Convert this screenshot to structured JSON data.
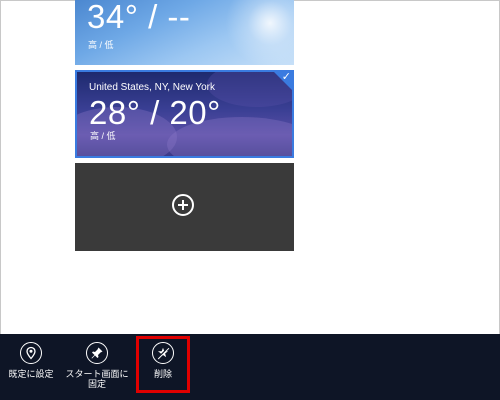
{
  "tiles": [
    {
      "temperature": "34° / --",
      "hilo_label": "高 / 低",
      "selected": false
    },
    {
      "location": "United States, NY, New York",
      "temperature": "28° / 20°",
      "hilo_label": "高 / 低",
      "selected": true
    }
  ],
  "add_tile": {
    "icon": "add-circle-icon"
  },
  "appbar": {
    "commands": [
      {
        "label": "既定に設定",
        "icon": "location-pin-icon"
      },
      {
        "label": "スタート画面に固定",
        "icon": "pin-icon"
      },
      {
        "label": "削除",
        "icon": "delete-star-icon",
        "highlighted": true
      }
    ]
  },
  "colors": {
    "selection_accent": "#3a7be0",
    "appbar_bg": "#0e1526",
    "add_tile_bg": "#3a3a3a",
    "highlight_box": "#e00000"
  }
}
